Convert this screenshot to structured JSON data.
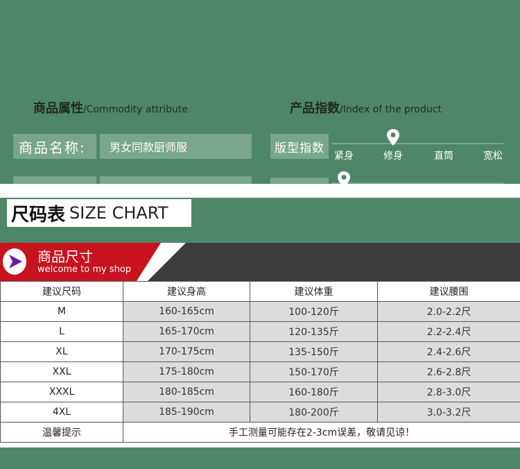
{
  "attributes": {
    "title_zh": "商品属性",
    "title_en": "/Commodity attribute",
    "name_label": "商品名称:",
    "name_value": "男女同款厨师服"
  },
  "index": {
    "title_zh": "产品指数",
    "title_en": "/Index of the product",
    "fit_label": "版型指数",
    "fit_options": [
      "紧身",
      "修身",
      "直筒",
      "宽松"
    ],
    "fit_selected": "修身",
    "pin_icon": "location-pin-icon"
  },
  "size_chart": {
    "title_zh": "尺码表",
    "title_en": "SIZE CHART",
    "banner_zh": "商品尺寸",
    "banner_en": "welcome to my shop",
    "banner_icon": "play-arrow-icon",
    "columns": [
      "建议尺码",
      "建议身高",
      "建议体重",
      "建议腰围"
    ],
    "rows": [
      [
        "M",
        "160-165cm",
        "100-120斤",
        "2.0-2.2尺"
      ],
      [
        "L",
        "165-170cm",
        "120-135斤",
        "2.2-2.4尺"
      ],
      [
        "XL",
        "170-175cm",
        "135-150斤",
        "2.4-2.6尺"
      ],
      [
        "XXL",
        "175-180cm",
        "150-170斤",
        "2.6-2.8尺"
      ],
      [
        "XXXL",
        "180-185cm",
        "160-180斤",
        "2.8-3.0尺"
      ],
      [
        "4XL",
        "185-190cm",
        "180-200斤",
        "3.0-3.2尺"
      ]
    ],
    "note_label": "温馨提示",
    "note_text": "手工测量可能存在2-3cm误差，敬请见谅！"
  },
  "colors": {
    "background": "#4f866a",
    "label_bg": "#7aa58e",
    "banner_red": "#c8121f",
    "banner_dark": "#3d3d3d",
    "cell_gray": "#dcdcdc"
  }
}
